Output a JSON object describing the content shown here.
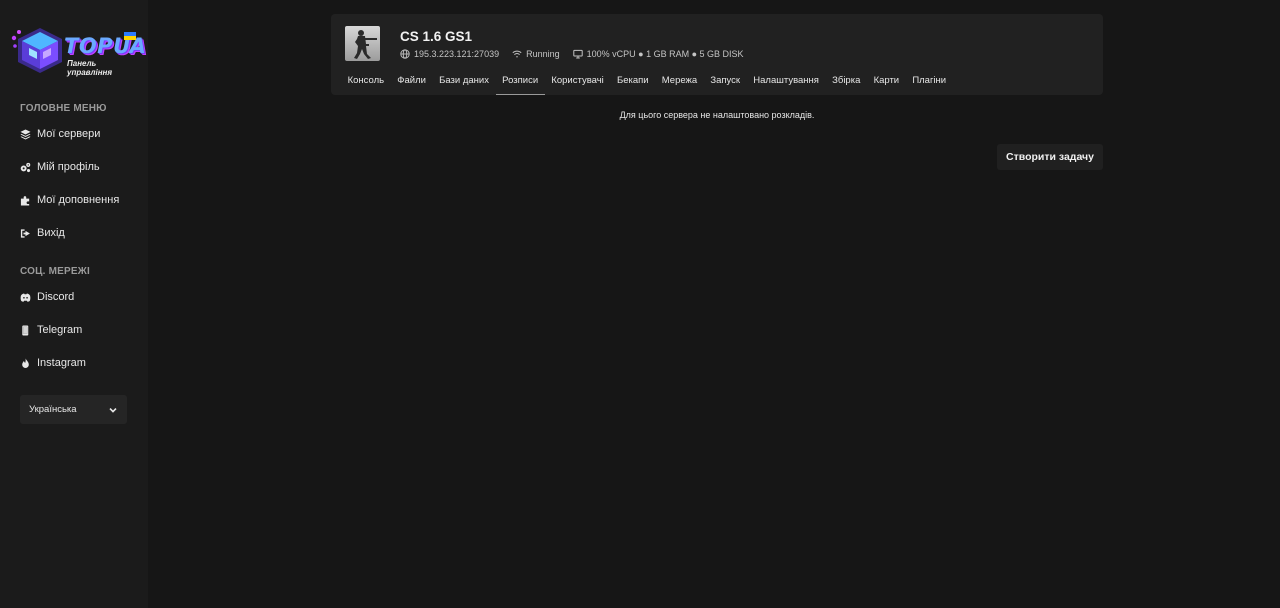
{
  "brand": {
    "name": "TOPUA",
    "subtitle": "Панель управління"
  },
  "sidebar": {
    "main_menu_title": "ГОЛОВНЕ МЕНЮ",
    "main_menu": [
      {
        "label": "Мої сервери",
        "icon": "layers-icon"
      },
      {
        "label": "Мій профіль",
        "icon": "gears-icon"
      },
      {
        "label": "Мої доповнення",
        "icon": "puzzle-icon"
      },
      {
        "label": "Вихід",
        "icon": "logout-icon"
      }
    ],
    "social_title": "СОЦ. МЕРЕЖІ",
    "social": [
      {
        "label": "Discord",
        "icon": "discord-icon"
      },
      {
        "label": "Telegram",
        "icon": "telegram-icon"
      },
      {
        "label": "Instagram",
        "icon": "instagram-icon"
      }
    ],
    "language": "Українська"
  },
  "server": {
    "name": "CS 1.6 GS1",
    "address": "195.3.223.121:27039",
    "status": "Running",
    "resources": "100% vCPU ● 1 GB RAM ● 5 GB DISK",
    "tabs": [
      "Консоль",
      "Файли",
      "Бази даних",
      "Розписи",
      "Користувачі",
      "Бекапи",
      "Мережа",
      "Запуск",
      "Налаштування",
      "Збірка",
      "Карти",
      "Плагіни"
    ],
    "active_tab": "Розписи"
  },
  "schedules": {
    "empty_message": "Для цього сервера не налаштовано розкладів.",
    "create_button": "Створити задачу"
  }
}
